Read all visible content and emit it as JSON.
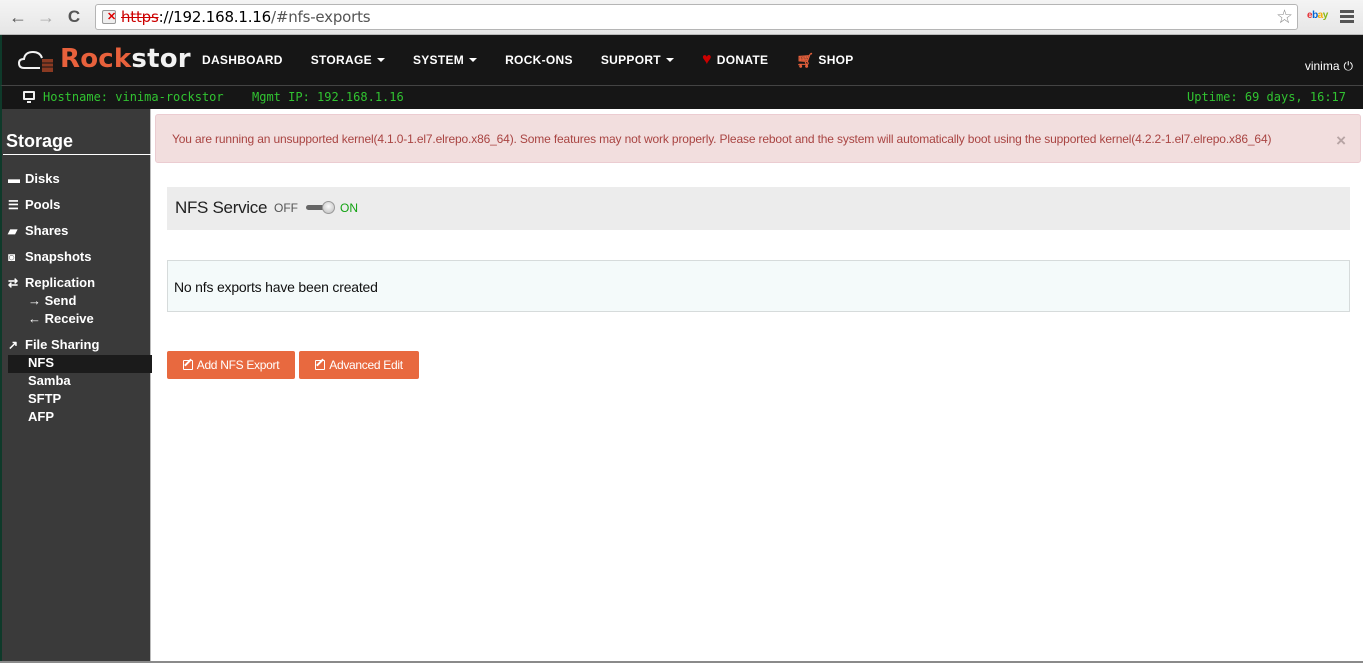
{
  "browser": {
    "url_scheme": "https",
    "url_host": "://192.168.1.16",
    "url_path": "/#nfs-exports",
    "back_icon": "←",
    "forward_icon": "→",
    "reload_icon": "C",
    "star_icon": "☆",
    "extension": {
      "e": "e",
      "b": "b",
      "a": "a",
      "y": "y"
    }
  },
  "navbar": {
    "brand_rock": "Rock",
    "brand_stor": "stor",
    "items": [
      {
        "label": "DASHBOARD",
        "dropdown": false
      },
      {
        "label": "STORAGE",
        "dropdown": true
      },
      {
        "label": "SYSTEM",
        "dropdown": true
      },
      {
        "label": "ROCK-ONS",
        "dropdown": false
      },
      {
        "label": "SUPPORT",
        "dropdown": true
      },
      {
        "label": "DONATE",
        "icon": "heart-icon"
      },
      {
        "label": "SHOP",
        "icon": "cart-icon"
      }
    ],
    "user": "vinima",
    "power_icon": "⏻",
    "heart_glyph": "♥",
    "cart_glyph": "🛒"
  },
  "status": {
    "hostname": "Hostname: vinima-rockstor",
    "mgmt_ip": "Mgmt IP: 192.168.1.16",
    "uptime": "Uptime: 69 days, 16:17"
  },
  "sidebar": {
    "title": "Storage",
    "items": [
      {
        "label": "Disks",
        "icon": "▬"
      },
      {
        "label": "Pools",
        "icon": "☰"
      },
      {
        "label": "Shares",
        "icon": "▰"
      },
      {
        "label": "Snapshots",
        "icon": "◙"
      },
      {
        "label": "Replication",
        "icon": "⇄"
      },
      {
        "label": "File Sharing",
        "icon": "↗"
      }
    ],
    "replication_sub": [
      {
        "label": "→ Send"
      },
      {
        "label": "← Receive"
      }
    ],
    "filesharing_sub": [
      {
        "label": "NFS",
        "active": true
      },
      {
        "label": "Samba"
      },
      {
        "label": "SFTP"
      },
      {
        "label": "AFP"
      }
    ]
  },
  "alert": {
    "text": "You are running an unsupported kernel(4.1.0-1.el7.elrepo.x86_64). Some features may not work properly. Please reboot and the system will automatically boot using the supported kernel(4.2.2-1.el7.elrepo.x86_64)",
    "close": "×"
  },
  "service": {
    "title": "NFS Service",
    "off_label": "OFF",
    "on_label": "ON",
    "state": "on"
  },
  "exports": {
    "empty_message": "No nfs exports have been created"
  },
  "actions": {
    "add_label": "Add NFS Export",
    "advanced_label": "Advanced Edit"
  },
  "colors": {
    "accent": "#e8693f",
    "status_green": "#31c331",
    "alert_bg": "#f2dede",
    "alert_text": "#a94442"
  }
}
